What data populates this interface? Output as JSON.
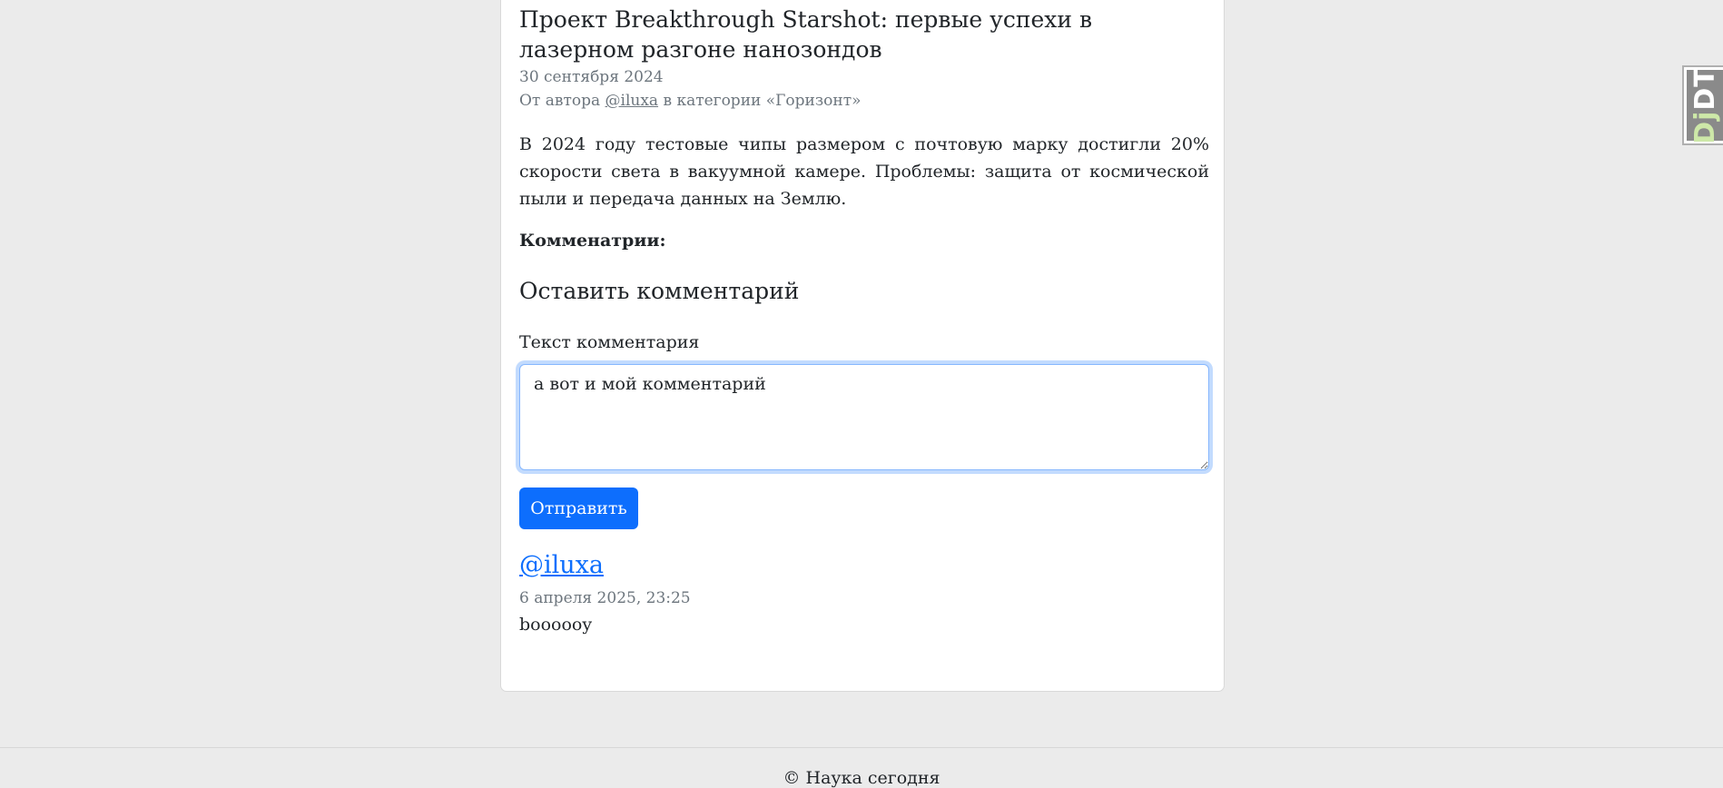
{
  "article": {
    "title": "Проект Breakthrough Starshot: первые успехи в лазерном разгоне нанозондов",
    "date": "30 сентября 2024",
    "byline_prefix": "От автора ",
    "author": "@iluxa",
    "byline_suffix": " в категории «Горизонт»",
    "body": "В 2024 году тестовые чипы размером с почтовую марку достигли 20% скорости света в вакуумной камере. Проблемы: защита от космической пыли и передача данных на Землю."
  },
  "comments": {
    "heading": "Комменатрии:",
    "form_heading": "Оставить комментарий",
    "field_label": "Текст комментария",
    "field_value": "а вот и мой комментарий",
    "submit_label": "Отправить",
    "items": [
      {
        "author": "@iluxa",
        "date": "6 апреля 2025, 23:25",
        "text": "boooooy"
      }
    ]
  },
  "footer": {
    "text": "© Наука сегодня"
  },
  "debug_toolbar": {
    "label_dj": "Dj",
    "label_dt": "DT"
  },
  "colors": {
    "accent": "#0d6efd",
    "background": "#ebebeb",
    "muted": "#6c757d"
  }
}
